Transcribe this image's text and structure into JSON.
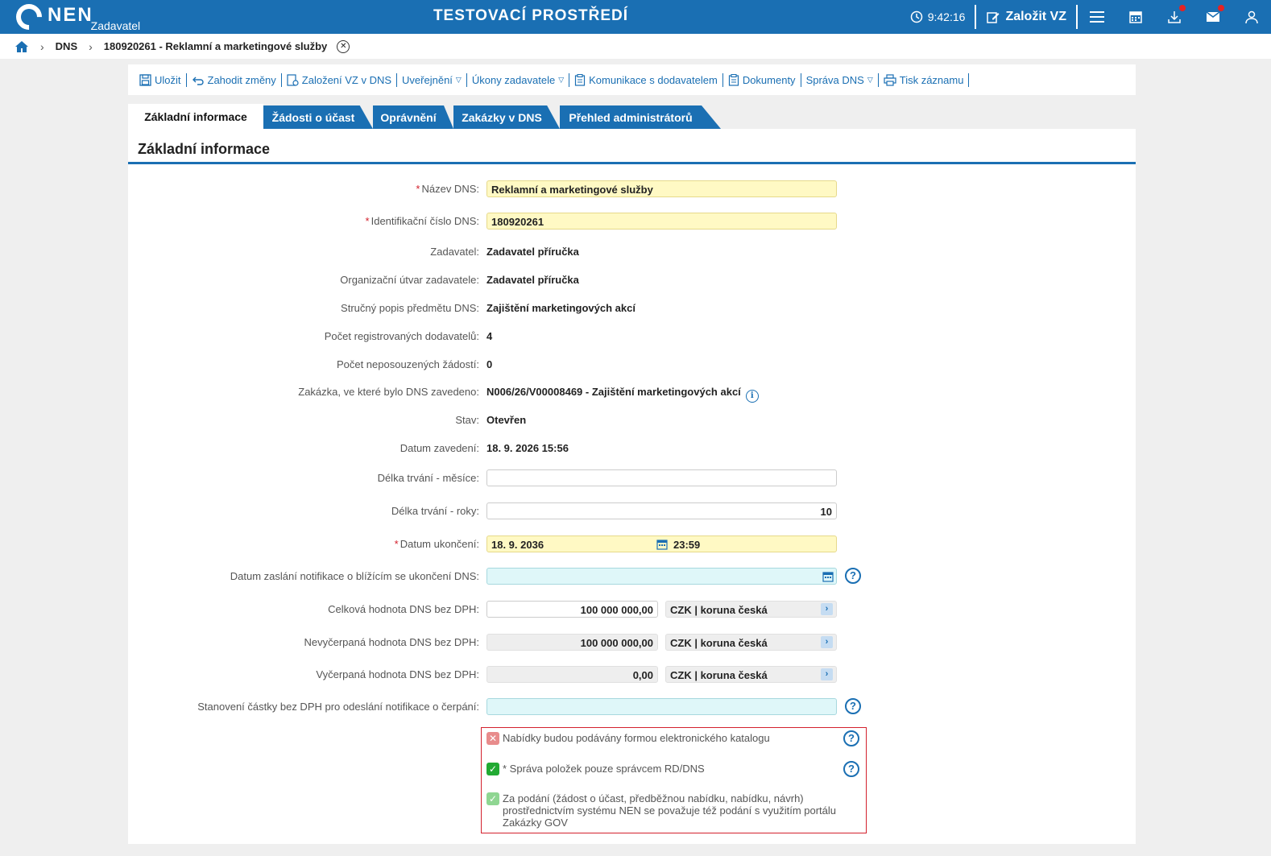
{
  "topbar": {
    "logo": "NEN",
    "role": "Zadavatel",
    "env_title": "TESTOVACÍ PROSTŘEDÍ",
    "time": "9:42:16",
    "create_label": "Založit VZ"
  },
  "breadcrumb": {
    "items": [
      "DNS",
      "180920261 - Reklamní a marketingové služby"
    ]
  },
  "toolbar": {
    "items": [
      "Uložit",
      "Zahodit změny",
      "Založení VZ v DNS",
      "Uveřejnění",
      "Úkony zadavatele",
      "Komunikace s dodavatelem",
      "Dokumenty",
      "Správa DNS",
      "Tisk záznamu"
    ]
  },
  "tabs": [
    "Základní informace",
    "Žádosti o účast",
    "Oprávnění",
    "Zakázky v DNS",
    "Přehled administrátorů"
  ],
  "panel": {
    "title": "Základní informace"
  },
  "form": {
    "nazev_label": "Název DNS:",
    "nazev_value": "Reklamní a marketingové služby",
    "id_label": "Identifikační číslo DNS:",
    "id_value": "180920261",
    "zadavatel_label": "Zadavatel:",
    "zadavatel_value": "Zadavatel příručka",
    "utvar_label": "Organizační útvar zadavatele:",
    "utvar_value": "Zadavatel příručka",
    "popis_label": "Stručný popis předmětu DNS:",
    "popis_value": "Zajištění marketingových akcí",
    "pocet_dod_label": "Počet registrovaných dodavatelů:",
    "pocet_dod_value": "4",
    "pocet_zad_label": "Počet neposouzených žádostí:",
    "pocet_zad_value": "0",
    "zakazka_label": "Zakázka, ve které bylo DNS zavedeno:",
    "zakazka_value": "N006/26/V00008469 - Zajištění marketingových akcí",
    "stav_label": "Stav:",
    "stav_value": "Otevřen",
    "datum_zav_label": "Datum zavedení:",
    "datum_zav_value": "18. 9. 2026 15:56",
    "delka_mesice_label": "Délka trvání - měsíce:",
    "delka_mesice_value": "",
    "delka_roky_label": "Délka trvání - roky:",
    "delka_roky_value": "10",
    "datum_ukon_label": "Datum ukončení:",
    "datum_ukon_date": "18. 9. 2036",
    "datum_ukon_time": "23:59",
    "notif_label": "Datum zaslání notifikace o blížícím se ukončení DNS:",
    "notif_value": "",
    "celkova_label": "Celková hodnota DNS bez DPH:",
    "celkova_value": "100 000 000,00",
    "nevycerp_label": "Nevyčerpaná hodnota DNS bez DPH:",
    "nevycerp_value": "100 000 000,00",
    "vycerp_label": "Vyčerpaná hodnota DNS bez DPH:",
    "vycerp_value": "0,00",
    "currency": "CZK | koruna česká",
    "castka_label": "Stanovení částky bez DPH pro odeslání notifikace o čerpání:",
    "castka_value": ""
  },
  "checks": {
    "katalog": "Nabídky budou podávány formou elektronického katalogu",
    "sprava": "* Správa položek pouze správcem RD/DNS",
    "podani": "Za podání (žádost o účast, předběžnou nabídku, nabídku, návrh) prostřednictvím systému NEN se považuje též podání s využitím portálu Zakázky GOV"
  },
  "colors": {
    "brand": "#1a6fb3",
    "required": "#d3212d",
    "highlight_yellow": "#fff9c4",
    "highlight_cyan": "#dff7f9"
  },
  "icons": [
    "home-icon",
    "clock-icon",
    "edit-icon",
    "menu-icon",
    "calendar-icon",
    "download-icon",
    "mail-icon",
    "user-icon",
    "save-icon",
    "undo-icon",
    "document-icon",
    "print-icon",
    "help-icon",
    "info-icon"
  ]
}
